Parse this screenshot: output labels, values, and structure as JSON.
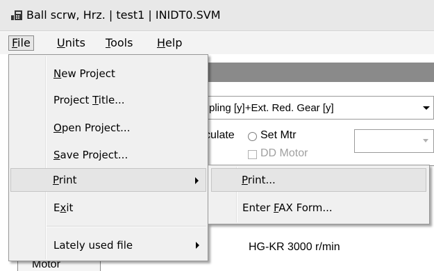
{
  "window": {
    "title": "Ball scrw, Hrz.  | test1 | INIDT0.SVM",
    "icon": "app-icon"
  },
  "menubar": {
    "items": [
      {
        "label": "File",
        "accel": "F",
        "rest": "ile"
      },
      {
        "label": "Units",
        "accel": "U",
        "rest": "nits"
      },
      {
        "label": "Tools",
        "accel": "T",
        "rest": "ools"
      },
      {
        "label": "Help",
        "accel": "H",
        "rest": "elp"
      }
    ]
  },
  "file_menu": {
    "items": [
      {
        "pre": "",
        "accel": "N",
        "post": "ew Project"
      },
      {
        "pre": "Project ",
        "accel": "T",
        "post": "itle..."
      },
      {
        "pre": "",
        "accel": "O",
        "post": "pen Project..."
      },
      {
        "pre": "",
        "accel": "S",
        "post": "ave Project..."
      },
      {
        "pre": "",
        "accel": "P",
        "post": "rint",
        "submenu": true
      },
      {
        "pre": "E",
        "accel": "x",
        "post": "it"
      },
      {
        "pre": "Lately used file",
        "accel": "",
        "post": "",
        "submenu": true
      }
    ]
  },
  "print_submenu": {
    "items": [
      {
        "pre": "",
        "accel": "P",
        "post": "rint..."
      },
      {
        "pre": "Enter ",
        "accel": "F",
        "post": "AX Form..."
      }
    ]
  },
  "background": {
    "combo_text": "pling [y]+Ext. Red. Gear [y]",
    "calc_label": "culate",
    "set_mtr_label": "Set Mtr",
    "dd_motor_label": "DD Motor",
    "motor_info": "HG-KR  3000 r/min",
    "tab_label": "Motor"
  },
  "colors": {
    "menu_bg": "#f0f0f0",
    "highlight": "#e5e5e5",
    "band": "#8a8a8a",
    "titlebar": "#e8e8e8"
  }
}
